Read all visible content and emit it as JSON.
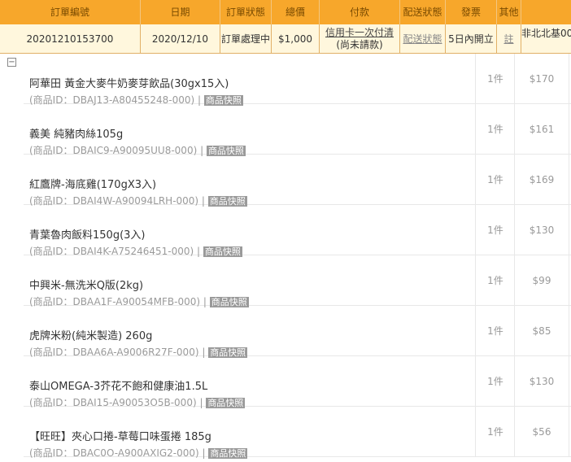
{
  "header": {
    "order_no": "訂單編號",
    "date": "日期",
    "order_status": "訂單狀態",
    "total": "總價",
    "payment": "付款",
    "delivery_status": "配送狀態",
    "invoice": "發票",
    "other": "其他"
  },
  "order": {
    "order_no": "20201210153700",
    "date": "2020/12/10",
    "status": "訂單處理中",
    "total": "$1,000",
    "payment_method": "信用卡一次付清",
    "payment_note": "(尚未請款)",
    "delivery_status": "配送狀態",
    "invoice": "5日內開立",
    "note": "註",
    "overflow_text": "非北北基00"
  },
  "toggle_symbol": "−",
  "items": [
    {
      "name": "阿華田 黃金大麥牛奶麥芽飲品(30gx15入)",
      "id": "(商品ID：DBAJ13-A80455248-000)",
      "sep": " | ",
      "snapshot": "商品快照",
      "qty": "1件",
      "price": "$170"
    },
    {
      "name": "義美 純豬肉絲105g",
      "id": "(商品ID：DBAIC9-A90095UU8-000)",
      "sep": " | ",
      "snapshot": "商品快照",
      "qty": "1件",
      "price": "$161"
    },
    {
      "name": "紅鷹牌-海底雞(170gX3入)",
      "id": "(商品ID：DBAI4W-A90094LRH-000)",
      "sep": " | ",
      "snapshot": "商品快照",
      "qty": "1件",
      "price": "$169"
    },
    {
      "name": "青葉魯肉飯料150g(3入)",
      "id": "(商品ID：DBAI4K-A75246451-000)",
      "sep": " | ",
      "snapshot": "商品快照",
      "qty": "1件",
      "price": "$130"
    },
    {
      "name": "中興米-無洗米Q版(2kg)",
      "id": "(商品ID：DBAA1F-A90054MFB-000)",
      "sep": " | ",
      "snapshot": "商品快照",
      "qty": "1件",
      "price": "$99"
    },
    {
      "name": "虎牌米粉(純米製造) 260g",
      "id": "(商品ID：DBAA6A-A9006R27F-000)",
      "sep": " | ",
      "snapshot": "商品快照",
      "qty": "1件",
      "price": "$85"
    },
    {
      "name": "泰山OMEGA-3芥花不飽和健康油1.5L",
      "id": "(商品ID：DBAI15-A90053O5B-000)",
      "sep": " | ",
      "snapshot": "商品快照",
      "qty": "1件",
      "price": "$130"
    },
    {
      "name": "【旺旺】夾心口捲-草莓口味蛋捲 185g",
      "id": "(商品ID：DBAC0O-A900AXIG2-000)",
      "sep": " | ",
      "snapshot": "商品快照",
      "qty": "1件",
      "price": "$56"
    }
  ],
  "colors": {
    "header_bg": "#f7a72b",
    "order_row_bg": "#fff7dd",
    "muted_text": "#9a9a9a"
  }
}
